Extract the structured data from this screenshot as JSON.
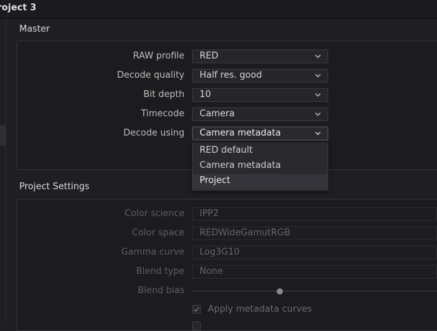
{
  "window": {
    "title": "roject 3"
  },
  "master": {
    "section_title": "Master",
    "rows": [
      {
        "label": "RAW profile",
        "value": "RED"
      },
      {
        "label": "Decode quality",
        "value": "Half res. good"
      },
      {
        "label": "Bit depth",
        "value": "10"
      },
      {
        "label": "Timecode",
        "value": "Camera"
      },
      {
        "label": "Decode using",
        "value": "Camera metadata"
      }
    ],
    "decode_menu_options": [
      "RED default",
      "Camera metadata",
      "Project"
    ],
    "decode_menu_highlighted": "Project"
  },
  "project_settings": {
    "section_title": "Project Settings",
    "rows": [
      {
        "label": "Color science",
        "value": "IPP2"
      },
      {
        "label": "Color space",
        "value": "REDWideGamutRGB"
      },
      {
        "label": "Gamma curve",
        "value": "Log3G10"
      },
      {
        "label": "Blend type",
        "value": "None"
      }
    ],
    "blend_bias_label": "Blend bias",
    "apply_metadata_curves_label": "Apply metadata curves",
    "apply_metadata_curves_checked": true
  },
  "colors": {
    "background": "#1f1f22",
    "panel_border": "#333338",
    "text": "#cfcfcf",
    "disabled_text": "#5f5f63"
  },
  "icons": {
    "dropdown": "chevron-down-icon",
    "checkbox": "checkmark-icon"
  }
}
